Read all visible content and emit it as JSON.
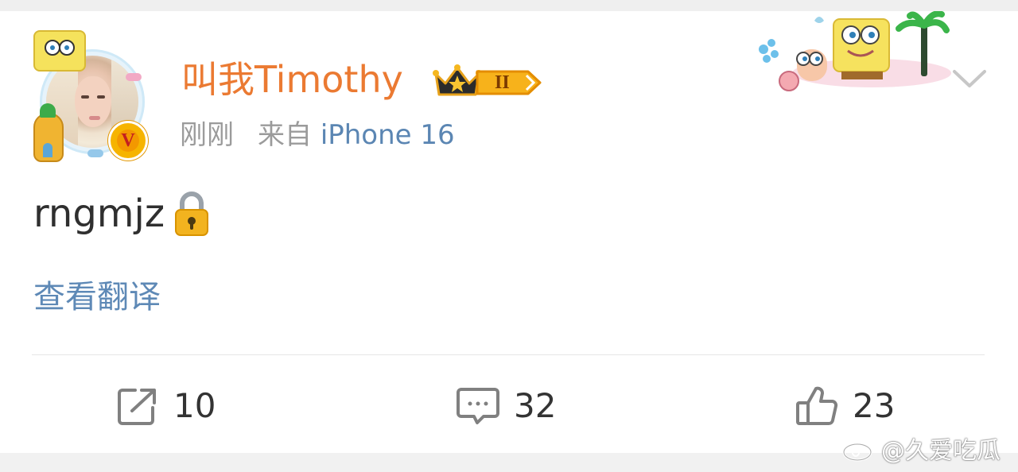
{
  "post": {
    "author": {
      "name": "叫我Timothy",
      "level_badge": "II",
      "verified_badge": "V"
    },
    "time": "刚刚",
    "source_prefix": "来自",
    "source_device": "iPhone 16",
    "text": "rngmjz",
    "text_emoji": "lock-icon",
    "translate_label": "查看翻译",
    "actions": {
      "repost_count": "10",
      "comment_count": "32",
      "like_count": "23"
    }
  },
  "watermark": {
    "text": "@久爱吃瓜"
  },
  "colors": {
    "username": "#eb7a32",
    "link": "#5b86b3",
    "meta": "#9b9b9b",
    "text": "#2f2f2f",
    "divider": "#e6e6e6",
    "badge_gold": "#f6b400"
  },
  "icons": [
    "avatar",
    "vip-v-icon",
    "crown-icon",
    "spongebob-decoration",
    "chevron-down-icon",
    "lock-icon",
    "repost-icon",
    "comment-icon",
    "like-icon",
    "weibo-logo-icon"
  ]
}
